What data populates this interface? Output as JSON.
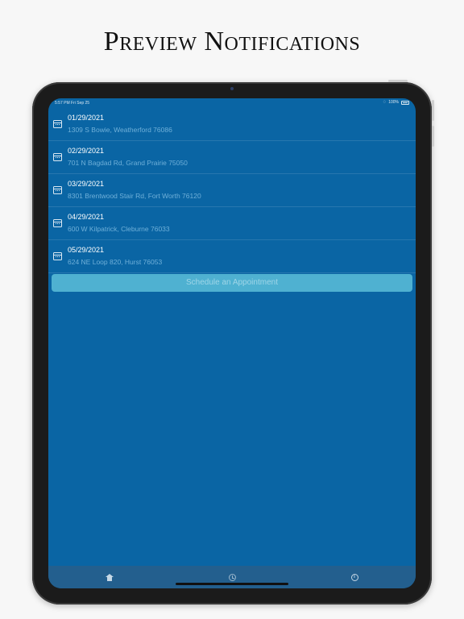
{
  "headline": "Preview Notifications",
  "status_bar": {
    "time": "5:57 PM  Fri Sep 25",
    "battery": "100%"
  },
  "appointments": [
    {
      "date": "01/29/2021",
      "address": "1309 S Bowie, Weatherford 76086"
    },
    {
      "date": "02/29/2021",
      "address": "701 N Bagdad Rd, Grand Prairie 75050"
    },
    {
      "date": "03/29/2021",
      "address": "8301 Brentwood Stair Rd, Fort Worth 76120"
    },
    {
      "date": "04/29/2021",
      "address": "600 W Kilpatrick, Cleburne 76033"
    },
    {
      "date": "05/29/2021",
      "address": "624 NE Loop 820, Hurst 76053"
    }
  ],
  "schedule_button": "Schedule an Appointment",
  "tabs": [
    {
      "icon": "home-icon"
    },
    {
      "icon": "clock-icon"
    },
    {
      "icon": "info-icon"
    }
  ],
  "colors": {
    "screen_bg": "#0a65a4",
    "button_bg": "#4fb1d1",
    "tab_bar_bg": "#235f8e"
  }
}
